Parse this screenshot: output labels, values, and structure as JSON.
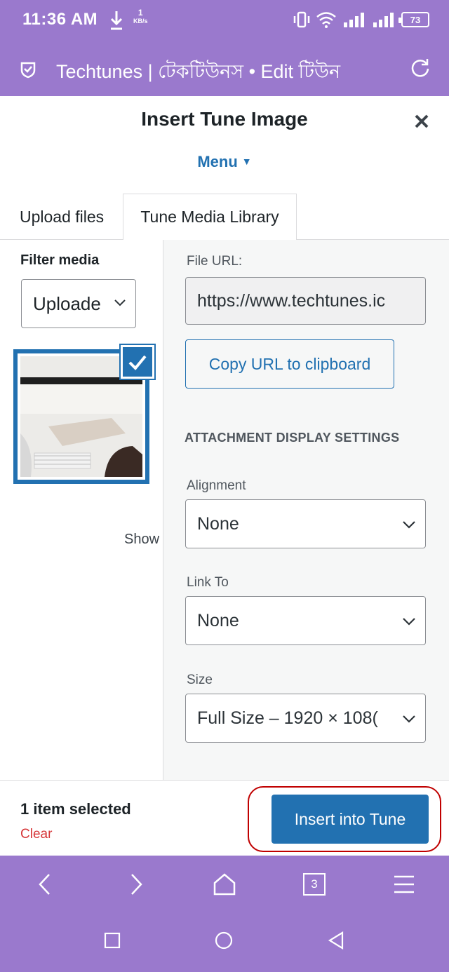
{
  "status": {
    "time": "11:36 AM",
    "speed_value": "1",
    "speed_unit": "KB/s",
    "battery": "73"
  },
  "browser": {
    "title": "Techtunes | টেকটিউনস • Edit টিউন"
  },
  "modal": {
    "title": "Insert Tune Image",
    "menu_label": "Menu",
    "tabs": [
      {
        "label": "Upload files"
      },
      {
        "label": "Tune Media Library"
      }
    ]
  },
  "filter": {
    "label": "Filter media",
    "selected": "Uploade"
  },
  "library": {
    "show_text": "Show"
  },
  "details": {
    "file_url_label": "File URL:",
    "file_url_value": "https://www.techtunes.ic",
    "copy_button": "Copy URL to clipboard",
    "section_title": "ATTACHMENT DISPLAY SETTINGS",
    "alignment_label": "Alignment",
    "alignment_value": "None",
    "link_to_label": "Link To",
    "link_to_value": "None",
    "size_label": "Size",
    "size_value": "Full Size – 1920 × 108("
  },
  "footer": {
    "selected_count": "1 item selected",
    "clear_label": "Clear",
    "insert_button": "Insert into Tune"
  },
  "nav": {
    "tab_count": "3"
  },
  "colors": {
    "accent": "#2271b1",
    "header": "#9a79cd",
    "danger": "#d63638",
    "highlight_outline": "#c00000"
  }
}
